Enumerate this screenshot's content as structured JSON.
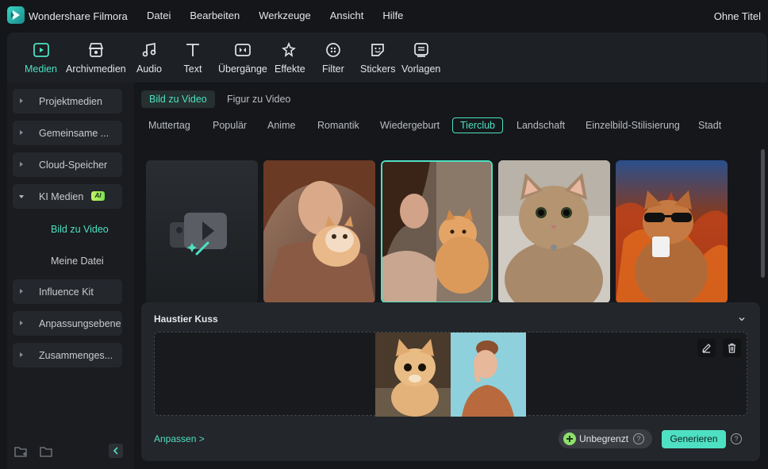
{
  "app": {
    "name": "Wondershare Filmora",
    "doc_title": "Ohne Titel"
  },
  "menu": [
    "Datei",
    "Bearbeiten",
    "Werkzeuge",
    "Ansicht",
    "Hilfe"
  ],
  "toolbar": [
    {
      "label": "Medien",
      "icon": "media-icon",
      "active": true
    },
    {
      "label": "Archivmedien",
      "icon": "stock-icon"
    },
    {
      "label": "Audio",
      "icon": "music-icon"
    },
    {
      "label": "Text",
      "icon": "text-icon"
    },
    {
      "label": "Übergänge",
      "icon": "transition-icon"
    },
    {
      "label": "Effekte",
      "icon": "effects-icon"
    },
    {
      "label": "Filter",
      "icon": "filter-icon"
    },
    {
      "label": "Stickers",
      "icon": "sticker-icon"
    },
    {
      "label": "Vorlagen",
      "icon": "template-icon"
    }
  ],
  "sidebar": {
    "items": [
      {
        "label": "Projektmedien"
      },
      {
        "label": "Gemeinsame ..."
      },
      {
        "label": "Cloud-Speicher"
      },
      {
        "label": "KI Medien",
        "badge": "AI",
        "expanded": true
      },
      {
        "label": "Influence Kit"
      },
      {
        "label": "Anpassungsebene"
      },
      {
        "label": "Zusammenges..."
      }
    ],
    "subitems": [
      {
        "label": "Bild zu Video",
        "active": true
      },
      {
        "label": "Meine Datei"
      }
    ]
  },
  "subtabs": [
    {
      "label": "Bild zu Video",
      "active": true
    },
    {
      "label": "Figur zu Video"
    }
  ],
  "categories": [
    {
      "label": "Muttertag"
    },
    {
      "label": "Populär"
    },
    {
      "label": "Anime"
    },
    {
      "label": "Romantik"
    },
    {
      "label": "Wiedergeburt"
    },
    {
      "label": "Tierclub",
      "active": true
    },
    {
      "label": "Landschaft"
    },
    {
      "label": "Einzelbild-Stilisierung"
    },
    {
      "label": "Stadt"
    }
  ],
  "panel": {
    "title": "Haustier Kuss",
    "customize": "Anpassen >",
    "unlimited": "Unbegrenzt",
    "generate": "Generieren",
    "help": "?"
  },
  "colors": {
    "accent": "#4ee0c2",
    "bg": "#141619",
    "panel": "#23262a"
  }
}
